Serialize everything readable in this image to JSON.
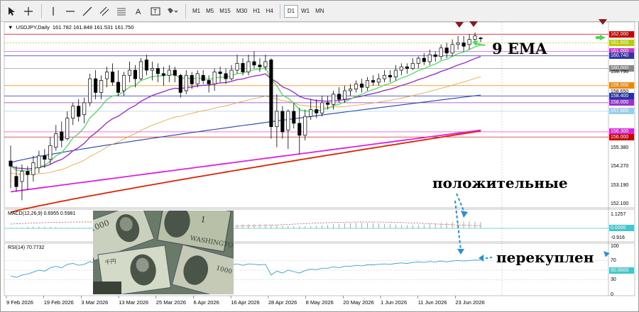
{
  "toolbar": {
    "timeframes": [
      "M1",
      "M5",
      "M15",
      "M30",
      "H1",
      "H4",
      "D1",
      "W1",
      "MN"
    ],
    "active_timeframe": "D1"
  },
  "chart_data": {
    "type": "candlestick",
    "symbol_title": "USDJPY,Daily",
    "ohlc_text": "161.782 161.848 161.531 161.750",
    "price_axis_labels": [
      "162.000",
      "161.500",
      "161.000",
      "160.740",
      "160.000",
      "159.790",
      "159.000",
      "158.650",
      "158.400",
      "158.000",
      "157.500",
      "156.300",
      "156.000",
      "155.380",
      "154.270",
      "153.190",
      "152.100"
    ],
    "date_labels": [
      "9 Feb 2026",
      "19 Feb 2026",
      "3 Mar 2026",
      "13 Mar 2026",
      "25 Mar 2026",
      "6 Apr 2026",
      "16 Apr 2026",
      "28 Apr 2026",
      "8 May 2026",
      "20 May 2026",
      "1 Jun 2026",
      "11 Jun 2026",
      "23 Jun 2026"
    ],
    "candles": [
      [
        154.6,
        154.3,
        155.5,
        153.0
      ],
      [
        153.7,
        153.1,
        154.3,
        152.8
      ],
      [
        153.4,
        154.0,
        154.4,
        152.3
      ],
      [
        154.0,
        153.8,
        154.3,
        152.9
      ],
      [
        153.8,
        154.5,
        154.9,
        153.4
      ],
      [
        154.2,
        154.9,
        155.2,
        153.9
      ],
      [
        154.9,
        154.7,
        155.3,
        154.2
      ],
      [
        154.7,
        155.5,
        156.0,
        154.4
      ],
      [
        155.4,
        156.2,
        156.7,
        155.2
      ],
      [
        156.3,
        155.8,
        156.9,
        155.4
      ],
      [
        155.9,
        157.1,
        157.5,
        155.8
      ],
      [
        157.1,
        157.8,
        158.0,
        156.7
      ],
      [
        157.8,
        157.2,
        158.2,
        156.9
      ],
      [
        157.3,
        158.0,
        158.3,
        156.8
      ],
      [
        158.0,
        159.4,
        159.7,
        157.8
      ],
      [
        159.4,
        158.6,
        159.9,
        158.2
      ],
      [
        158.6,
        159.3,
        159.6,
        158.2
      ],
      [
        159.4,
        159.8,
        160.1,
        158.9
      ],
      [
        159.8,
        159.2,
        160.3,
        159.0
      ],
      [
        159.2,
        158.6,
        159.9,
        158.4
      ],
      [
        158.7,
        159.6,
        159.8,
        158.4
      ],
      [
        159.6,
        159.9,
        160.4,
        159.2
      ],
      [
        159.9,
        159.4,
        160.2,
        158.9
      ],
      [
        159.4,
        160.4,
        160.6,
        159.3
      ],
      [
        160.5,
        159.9,
        160.8,
        159.6
      ],
      [
        159.9,
        160.0,
        160.4,
        159.3
      ],
      [
        160.0,
        159.7,
        160.3,
        159.2
      ],
      [
        159.7,
        159.6,
        160.1,
        159.0
      ],
      [
        159.6,
        159.9,
        160.2,
        159.2
      ],
      [
        159.9,
        159.6,
        160.1,
        159.2
      ],
      [
        159.6,
        158.6,
        159.7,
        158.3
      ],
      [
        158.7,
        159.6,
        159.9,
        158.5
      ],
      [
        159.6,
        159.1,
        159.8,
        158.8
      ],
      [
        159.1,
        159.7,
        159.9,
        158.9
      ],
      [
        159.6,
        159.3,
        159.9,
        159.1
      ],
      [
        159.3,
        159.1,
        159.6,
        158.6
      ],
      [
        159.1,
        159.8,
        160.0,
        158.7
      ],
      [
        159.8,
        159.7,
        160.1,
        159.2
      ],
      [
        159.7,
        159.4,
        160.0,
        159.1
      ],
      [
        159.4,
        159.9,
        160.2,
        159.3
      ],
      [
        159.9,
        160.3,
        160.8,
        159.7
      ],
      [
        160.3,
        159.8,
        160.6,
        159.6
      ],
      [
        159.8,
        160.4,
        160.8,
        159.6
      ],
      [
        160.4,
        160.2,
        161.0,
        160.0
      ],
      [
        160.2,
        160.1,
        160.6,
        159.8
      ],
      [
        160.1,
        160.4,
        160.8,
        159.9
      ],
      [
        160.5,
        156.6,
        160.6,
        155.9
      ],
      [
        156.6,
        157.5,
        158.5,
        155.4
      ],
      [
        157.5,
        156.3,
        157.8,
        155.9
      ],
      [
        156.4,
        157.5,
        157.6,
        155.3
      ],
      [
        157.5,
        156.8,
        158.0,
        156.5
      ],
      [
        156.8,
        156.1,
        157.7,
        155.0
      ],
      [
        156.1,
        157.2,
        157.6,
        155.8
      ],
      [
        157.2,
        157.6,
        158.2,
        157.0
      ],
      [
        157.6,
        157.4,
        158.2,
        157.1
      ],
      [
        157.4,
        158.0,
        158.4,
        157.2
      ],
      [
        158.0,
        157.9,
        158.4,
        157.6
      ],
      [
        157.9,
        158.5,
        158.7,
        157.6
      ],
      [
        158.5,
        158.2,
        158.9,
        158.0
      ],
      [
        158.2,
        158.7,
        159.0,
        158.0
      ],
      [
        158.7,
        158.8,
        159.1,
        158.4
      ],
      [
        158.8,
        159.1,
        159.3,
        158.6
      ],
      [
        159.1,
        158.9,
        159.4,
        158.6
      ],
      [
        158.9,
        159.3,
        159.5,
        158.7
      ],
      [
        159.3,
        159.2,
        159.6,
        159.0
      ],
      [
        159.2,
        159.4,
        159.7,
        159.0
      ],
      [
        159.4,
        159.6,
        159.9,
        159.2
      ],
      [
        159.6,
        159.5,
        159.9,
        159.2
      ],
      [
        159.5,
        159.9,
        160.2,
        159.3
      ],
      [
        159.9,
        160.1,
        160.3,
        159.6
      ],
      [
        160.1,
        160.0,
        160.3,
        159.7
      ],
      [
        160.0,
        160.3,
        160.6,
        159.9
      ],
      [
        160.3,
        160.6,
        160.7,
        160.0
      ],
      [
        160.6,
        160.4,
        160.9,
        160.2
      ],
      [
        160.4,
        160.8,
        161.1,
        160.2
      ],
      [
        160.8,
        160.7,
        161.0,
        160.4
      ],
      [
        160.7,
        161.2,
        161.4,
        160.5
      ],
      [
        161.2,
        160.9,
        161.5,
        160.6
      ],
      [
        160.9,
        161.4,
        161.7,
        160.7
      ],
      [
        161.4,
        161.5,
        161.9,
        161.1
      ],
      [
        161.5,
        161.3,
        161.9,
        161.0
      ],
      [
        161.4,
        161.7,
        162.0,
        161.1
      ],
      [
        161.7,
        161.9,
        162.1,
        161.4
      ],
      [
        161.78,
        161.75,
        161.85,
        161.53
      ]
    ],
    "ma_lines": [
      {
        "name": "9 EMA",
        "color": "#44dd55"
      },
      {
        "name": "",
        "color": "#9933cc"
      },
      {
        "name": "",
        "color": "#e8a030"
      },
      {
        "name": "",
        "color": "#2244aa"
      },
      {
        "name": "",
        "color": "#dd22dd"
      },
      {
        "name": "",
        "color": "#dd2200"
      }
    ],
    "horizontal_levels": [
      {
        "price": "162.000",
        "color": "#cc0000"
      },
      {
        "price": "161.500",
        "color": "#bbcc00"
      },
      {
        "price": "161.000",
        "color": "#cc33cc"
      },
      {
        "price": "160.740",
        "color": "#3333aa"
      },
      {
        "price": "160.000",
        "color": "#888888"
      },
      {
        "price": "159.000",
        "color": "#ee8800"
      },
      {
        "price": "158.400",
        "color": "#2233aa"
      },
      {
        "price": "158.000",
        "color": "#9933cc"
      },
      {
        "price": "157.500",
        "color": "#99ccee"
      },
      {
        "price": "156.300",
        "color": "#dd22dd"
      },
      {
        "price": "156.000",
        "color": "#cc0000"
      }
    ],
    "macd": {
      "title": "MACD(12,26,9) 0.6955 0.5981",
      "axis_labels": [
        "1.1257",
        "0.0000",
        "-0.916"
      ]
    },
    "rsi": {
      "title": "RSI(14) 70.7732",
      "axis_labels": [
        "100",
        "70",
        "50.0000",
        "30",
        "0"
      ],
      "values": [
        38,
        35,
        40,
        42,
        46,
        50,
        48,
        55,
        58,
        55,
        62,
        64,
        60,
        62,
        68,
        63,
        65,
        66,
        62,
        58,
        62,
        63,
        60,
        64,
        61,
        61,
        59,
        59,
        61,
        59,
        54,
        59,
        57,
        60,
        58,
        57,
        60,
        60,
        58,
        61,
        63,
        60,
        63,
        62,
        61,
        62,
        40,
        48,
        44,
        50,
        47,
        44,
        49,
        52,
        51,
        54,
        54,
        57,
        55,
        58,
        58,
        60,
        59,
        61,
        61,
        62,
        63,
        62,
        64,
        65,
        64,
        66,
        67,
        66,
        68,
        67,
        69,
        67,
        69,
        70,
        69,
        70,
        71,
        70.8
      ]
    }
  },
  "annotations": {
    "ema_label": "9 EMA",
    "positive": "положительные",
    "overbought": "перекуплен"
  },
  "colors": {
    "annotation_blue": "#2b8fd6",
    "annotation_green": "#44dd55",
    "arrow_red": "#8b1a1a",
    "rsi_line": "#3aa0d0",
    "macd_zero": "#40c8d0"
  }
}
